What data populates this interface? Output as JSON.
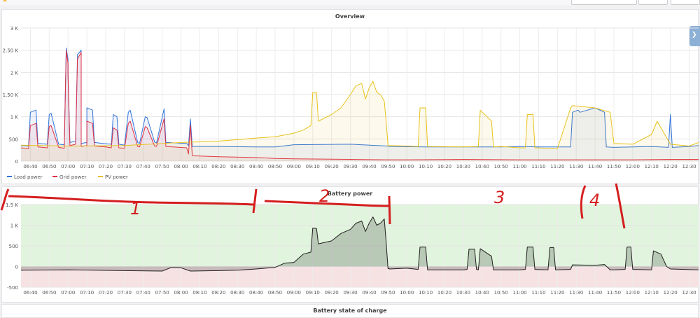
{
  "overview": {
    "title": "Overview",
    "legend": [
      {
        "label": "Load power",
        "color": "#3274d9"
      },
      {
        "label": "Grid power",
        "color": "#e02f44"
      },
      {
        "label": "PV power",
        "color": "#e8c21b"
      }
    ]
  },
  "battery": {
    "title": "Battery power"
  },
  "soc": {
    "title": "Battery state of charge"
  },
  "annotations": [
    "1",
    "2",
    "3",
    "4"
  ],
  "chart_data": [
    {
      "type": "line",
      "title": "Overview",
      "ylim": [
        0,
        3000
      ],
      "yticks": [
        0,
        500,
        1000,
        1500,
        2000,
        2500,
        3000
      ],
      "ytick_labels": [
        "0",
        "500",
        "1 K",
        "1.50 K",
        "2 K",
        "2.50 K",
        "3 K"
      ],
      "xlim": [
        "06:35",
        "12:35"
      ],
      "x_tick_labels": [
        "06:40",
        "06:50",
        "07:00",
        "07:10",
        "07:20",
        "07:30",
        "07:40",
        "07:50",
        "08:00",
        "08:10",
        "08:20",
        "08:30",
        "08:40",
        "08:50",
        "09:00",
        "09:10",
        "09:20",
        "09:30",
        "09:40",
        "09:50",
        "10:00",
        "10:10",
        "10:20",
        "10:30",
        "10:40",
        "10:50",
        "11:00",
        "11:10",
        "11:20",
        "11:30",
        "11:40",
        "11:50",
        "12:00",
        "12:10",
        "12:20",
        "12:30"
      ],
      "grid": true,
      "legend_position": "bottom-left",
      "series": [
        {
          "name": "Load power",
          "color": "#3274d9",
          "x": [
            "06:35",
            "06:39",
            "06:40",
            "06:43",
            "06:44",
            "06:49",
            "06:50",
            "06:51",
            "06:55",
            "06:58",
            "06:59",
            "06:59",
            "07:00",
            "07:00",
            "07:01",
            "07:04",
            "07:05",
            "07:07",
            "07:07",
            "07:10",
            "07:10",
            "07:13",
            "07:14",
            "07:20",
            "07:23",
            "07:24",
            "07:26",
            "07:27",
            "07:30",
            "07:32",
            "07:33",
            "07:37",
            "07:38",
            "07:41",
            "07:42",
            "07:46",
            "07:47",
            "07:51",
            "07:52",
            "08:03",
            "08:04",
            "08:05",
            "08:06",
            "08:20",
            "08:40",
            "08:50",
            "09:00",
            "09:30",
            "09:50",
            "09:51",
            "10:10",
            "10:30",
            "10:50",
            "11:00",
            "11:10",
            "11:20",
            "11:27",
            "11:28",
            "11:31",
            "11:32",
            "11:40",
            "11:45",
            "11:46",
            "11:50",
            "12:00",
            "12:10",
            "12:19",
            "12:20",
            "12:21",
            "12:30",
            "12:35"
          ],
          "y": [
            350,
            340,
            1100,
            1150,
            400,
            380,
            1050,
            1080,
            380,
            370,
            2450,
            2550,
            2300,
            2000,
            420,
            450,
            2400,
            2500,
            400,
            420,
            1200,
            1150,
            420,
            390,
            380,
            1050,
            1000,
            380,
            360,
            1100,
            1150,
            420,
            400,
            1000,
            980,
            430,
            410,
            1180,
            420,
            400,
            350,
            950,
            330,
            330,
            320,
            320,
            370,
            380,
            340,
            330,
            320,
            320,
            320,
            330,
            320,
            320,
            320,
            1100,
            1150,
            1100,
            1200,
            1100,
            320,
            310,
            320,
            330,
            310,
            1050,
            310,
            330,
            350
          ]
        },
        {
          "name": "Grid power",
          "color": "#e02f44",
          "x": [
            "06:35",
            "06:39",
            "06:40",
            "06:43",
            "06:44",
            "06:49",
            "06:50",
            "06:51",
            "06:55",
            "06:58",
            "06:59",
            "06:59",
            "07:00",
            "07:00",
            "07:01",
            "07:04",
            "07:05",
            "07:07",
            "07:07",
            "07:10",
            "07:10",
            "07:13",
            "07:14",
            "07:20",
            "07:23",
            "07:24",
            "07:26",
            "07:27",
            "07:30",
            "07:32",
            "07:33",
            "07:37",
            "07:38",
            "07:41",
            "07:42",
            "07:46",
            "07:47",
            "07:51",
            "07:52",
            "08:03",
            "08:04",
            "08:05",
            "08:06",
            "08:20",
            "08:40",
            "08:50",
            "09:00",
            "09:30",
            "09:50",
            "10:00",
            "10:30",
            "11:00",
            "11:30",
            "12:00",
            "12:20",
            "12:35"
          ],
          "y": [
            300,
            280,
            800,
            850,
            320,
            300,
            780,
            800,
            310,
            290,
            2400,
            2500,
            2200,
            1900,
            350,
            380,
            2300,
            2450,
            330,
            350,
            900,
            850,
            340,
            320,
            300,
            750,
            700,
            300,
            290,
            850,
            900,
            330,
            320,
            780,
            750,
            340,
            330,
            950,
            330,
            300,
            160,
            820,
            120,
            100,
            80,
            60,
            50,
            40,
            30,
            30,
            40,
            30,
            30,
            30,
            40,
            40
          ]
        },
        {
          "name": "PV power",
          "color": "#e8c21b",
          "x": [
            "06:35",
            "07:00",
            "07:30",
            "08:00",
            "08:20",
            "08:40",
            "08:50",
            "09:00",
            "09:05",
            "09:09",
            "09:10",
            "09:12",
            "09:13",
            "09:20",
            "09:25",
            "09:30",
            "09:33",
            "09:36",
            "09:38",
            "09:40",
            "09:42",
            "09:44",
            "09:46",
            "09:48",
            "09:49",
            "09:50",
            "10:00",
            "10:06",
            "10:07",
            "10:10",
            "10:11",
            "10:30",
            "10:38",
            "10:39",
            "10:45",
            "10:46",
            "10:50",
            "11:00",
            "11:03",
            "11:04",
            "11:07",
            "11:08",
            "11:20",
            "11:27",
            "11:28",
            "11:40",
            "11:48",
            "11:50",
            "12:00",
            "12:10",
            "12:13",
            "12:20",
            "12:30",
            "12:35"
          ],
          "y": [
            360,
            340,
            350,
            420,
            450,
            520,
            550,
            630,
            700,
            800,
            1550,
            1550,
            900,
            1050,
            1200,
            1500,
            1700,
            1750,
            1400,
            1650,
            1800,
            1550,
            1500,
            1350,
            900,
            350,
            340,
            330,
            1200,
            1200,
            330,
            320,
            330,
            1150,
            900,
            320,
            330,
            300,
            300,
            1050,
            1050,
            300,
            280,
            1200,
            1250,
            1200,
            1100,
            400,
            380,
            600,
            900,
            380,
            340,
            420
          ]
        }
      ]
    },
    {
      "type": "area",
      "title": "Battery power",
      "ylim": [
        -500,
        1500
      ],
      "yticks": [
        -500,
        0,
        500,
        1000,
        1500
      ],
      "ytick_labels": [
        "-500",
        "0",
        "500",
        "1 K",
        "1.5 K"
      ],
      "xlim": [
        "06:35",
        "12:35"
      ],
      "grid": true,
      "thresholds": [
        {
          "from": 0,
          "to": 1500,
          "color": "#e1f4dd"
        },
        {
          "from": -500,
          "to": 0,
          "color": "#f7e2e3"
        }
      ],
      "series": [
        {
          "name": "",
          "color": "#1f1f1f",
          "x": [
            "06:35",
            "07:00",
            "07:30",
            "07:50",
            "07:55",
            "08:00",
            "08:05",
            "08:20",
            "08:30",
            "08:40",
            "08:50",
            "08:55",
            "09:00",
            "09:05",
            "09:09",
            "09:10",
            "09:12",
            "09:13",
            "09:20",
            "09:25",
            "09:30",
            "09:33",
            "09:36",
            "09:38",
            "09:40",
            "09:42",
            "09:44",
            "09:46",
            "09:48",
            "09:49",
            "09:50",
            "09:51",
            "10:00",
            "10:06",
            "10:07",
            "10:10",
            "10:11",
            "10:30",
            "10:32",
            "10:33",
            "10:36",
            "10:37",
            "10:38",
            "10:39",
            "10:45",
            "10:46",
            "11:00",
            "11:03",
            "11:04",
            "11:07",
            "11:08",
            "11:15",
            "11:16",
            "11:18",
            "11:19",
            "11:27",
            "11:28",
            "11:40",
            "11:45",
            "11:48",
            "11:50",
            "11:56",
            "11:57",
            "11:59",
            "12:00",
            "12:10",
            "12:11",
            "12:15",
            "12:18",
            "12:20",
            "12:35"
          ],
          "y": [
            -90,
            -80,
            -100,
            -110,
            -20,
            -30,
            -110,
            -100,
            -90,
            -60,
            -20,
            80,
            100,
            300,
            350,
            930,
            920,
            550,
            620,
            800,
            900,
            1050,
            1100,
            850,
            1050,
            1200,
            1000,
            1050,
            1150,
            600,
            -50,
            -60,
            -40,
            -70,
            470,
            470,
            -80,
            -80,
            -70,
            420,
            420,
            -70,
            -80,
            430,
            250,
            -80,
            -80,
            -70,
            470,
            470,
            -70,
            -80,
            460,
            460,
            -80,
            -70,
            40,
            30,
            50,
            -80,
            -80,
            -70,
            470,
            470,
            -70,
            -80,
            380,
            300,
            0,
            -60,
            -80
          ]
        }
      ]
    }
  ]
}
